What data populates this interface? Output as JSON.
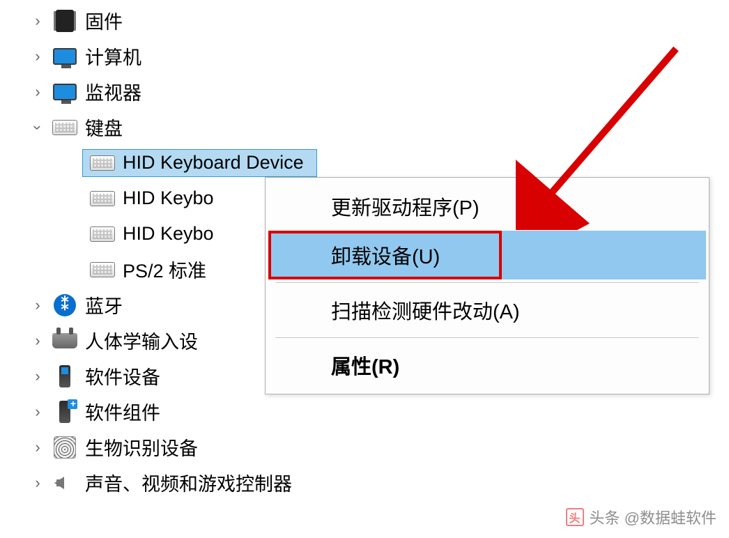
{
  "tree": {
    "firmware": "固件",
    "computer": "计算机",
    "monitor": "监视器",
    "keyboard": "键盘",
    "kb_children": {
      "item0": "HID Keyboard Device",
      "item1": "HID Keybo",
      "item2": "HID Keybo",
      "item3": "PS/2 标准"
    },
    "bluetooth": "蓝牙",
    "hid": "人体学输入设",
    "softdev": "软件设备",
    "softcomp": "软件组件",
    "biometric": "生物识别设备",
    "sound": "声音、视频和游戏控制器"
  },
  "menu": {
    "update": "更新驱动程序(P)",
    "uninstall": "卸载设备(U)",
    "scan": "扫描检测硬件改动(A)",
    "properties": "属性(R)"
  },
  "watermark": {
    "logo": "头",
    "text": "头条 @数据蛙软件"
  }
}
